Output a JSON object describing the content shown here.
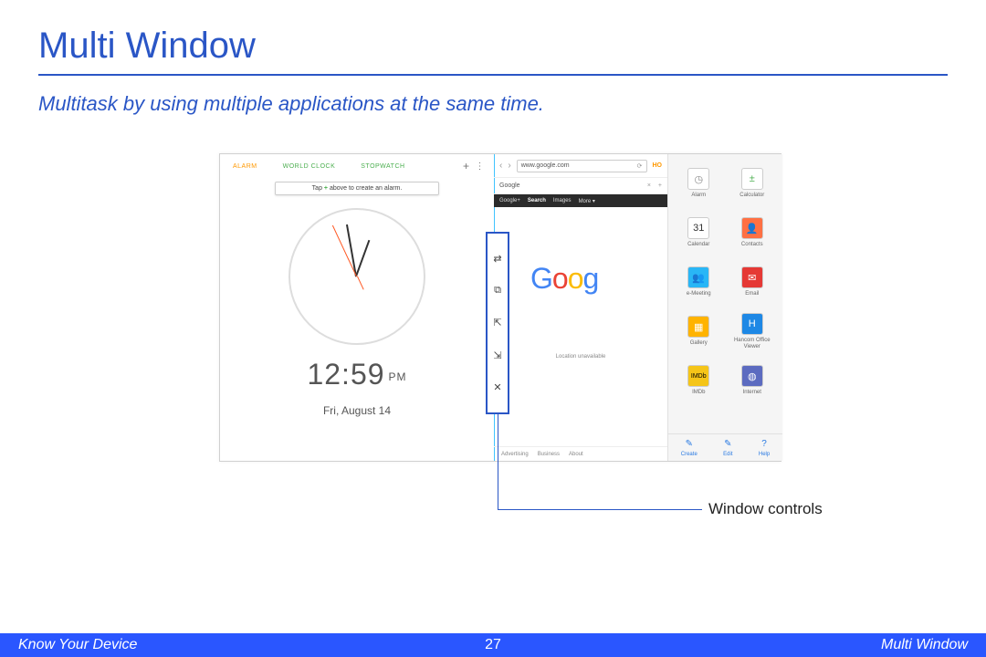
{
  "title": "Multi Window",
  "subtitle": "Multitask by using multiple applications at the same time.",
  "clock": {
    "tabs": [
      "ALARM",
      "WORLD CLOCK",
      "STOPWATCH"
    ],
    "tip_pre": "Tap ",
    "tip_plus": "+",
    "tip_post": " above to create an alarm.",
    "time": "12:59",
    "ampm": "PM",
    "date": "Fri, August 14"
  },
  "browser": {
    "url": "www.google.com",
    "home": "HO",
    "tab_label": "Google",
    "nav": [
      "Google+",
      "Search",
      "Images",
      "More ▾"
    ],
    "logo": "Goog",
    "loc": "Location unavailable",
    "foot": [
      "Advertising",
      "Business",
      "About"
    ]
  },
  "tray": {
    "items": [
      {
        "label": "Alarm",
        "glyph": "◷",
        "bg": "#ffffff",
        "fg": "#888"
      },
      {
        "label": "Calculator",
        "glyph": "±",
        "bg": "#ffffff",
        "fg": "#4caf50"
      },
      {
        "label": "Calendar",
        "glyph": "31",
        "bg": "#ffffff",
        "fg": "#333"
      },
      {
        "label": "Contacts",
        "glyph": "👤",
        "bg": "#ff7043",
        "fg": "#fff"
      },
      {
        "label": "e-Meeting",
        "glyph": "👥",
        "bg": "#29b6f6",
        "fg": "#fff"
      },
      {
        "label": "Email",
        "glyph": "✉",
        "bg": "#e53935",
        "fg": "#fff"
      },
      {
        "label": "Gallery",
        "glyph": "▦",
        "bg": "#ffb300",
        "fg": "#fff"
      },
      {
        "label": "Hancom Office Viewer",
        "glyph": "H",
        "bg": "#1e88e5",
        "fg": "#fff"
      },
      {
        "label": "IMDb",
        "glyph": "IMDb",
        "bg": "#f5c518",
        "fg": "#000"
      },
      {
        "label": "Internet",
        "glyph": "◍",
        "bg": "#5c6bc0",
        "fg": "#fff"
      }
    ],
    "foot": [
      {
        "label": "Create",
        "glyph": "✎"
      },
      {
        "label": "Edit",
        "glyph": "✎"
      },
      {
        "label": "Help",
        "glyph": "?"
      }
    ]
  },
  "callout": "Window controls",
  "footer": {
    "left": "Know Your Device",
    "page": "27",
    "right": "Multi Window"
  }
}
